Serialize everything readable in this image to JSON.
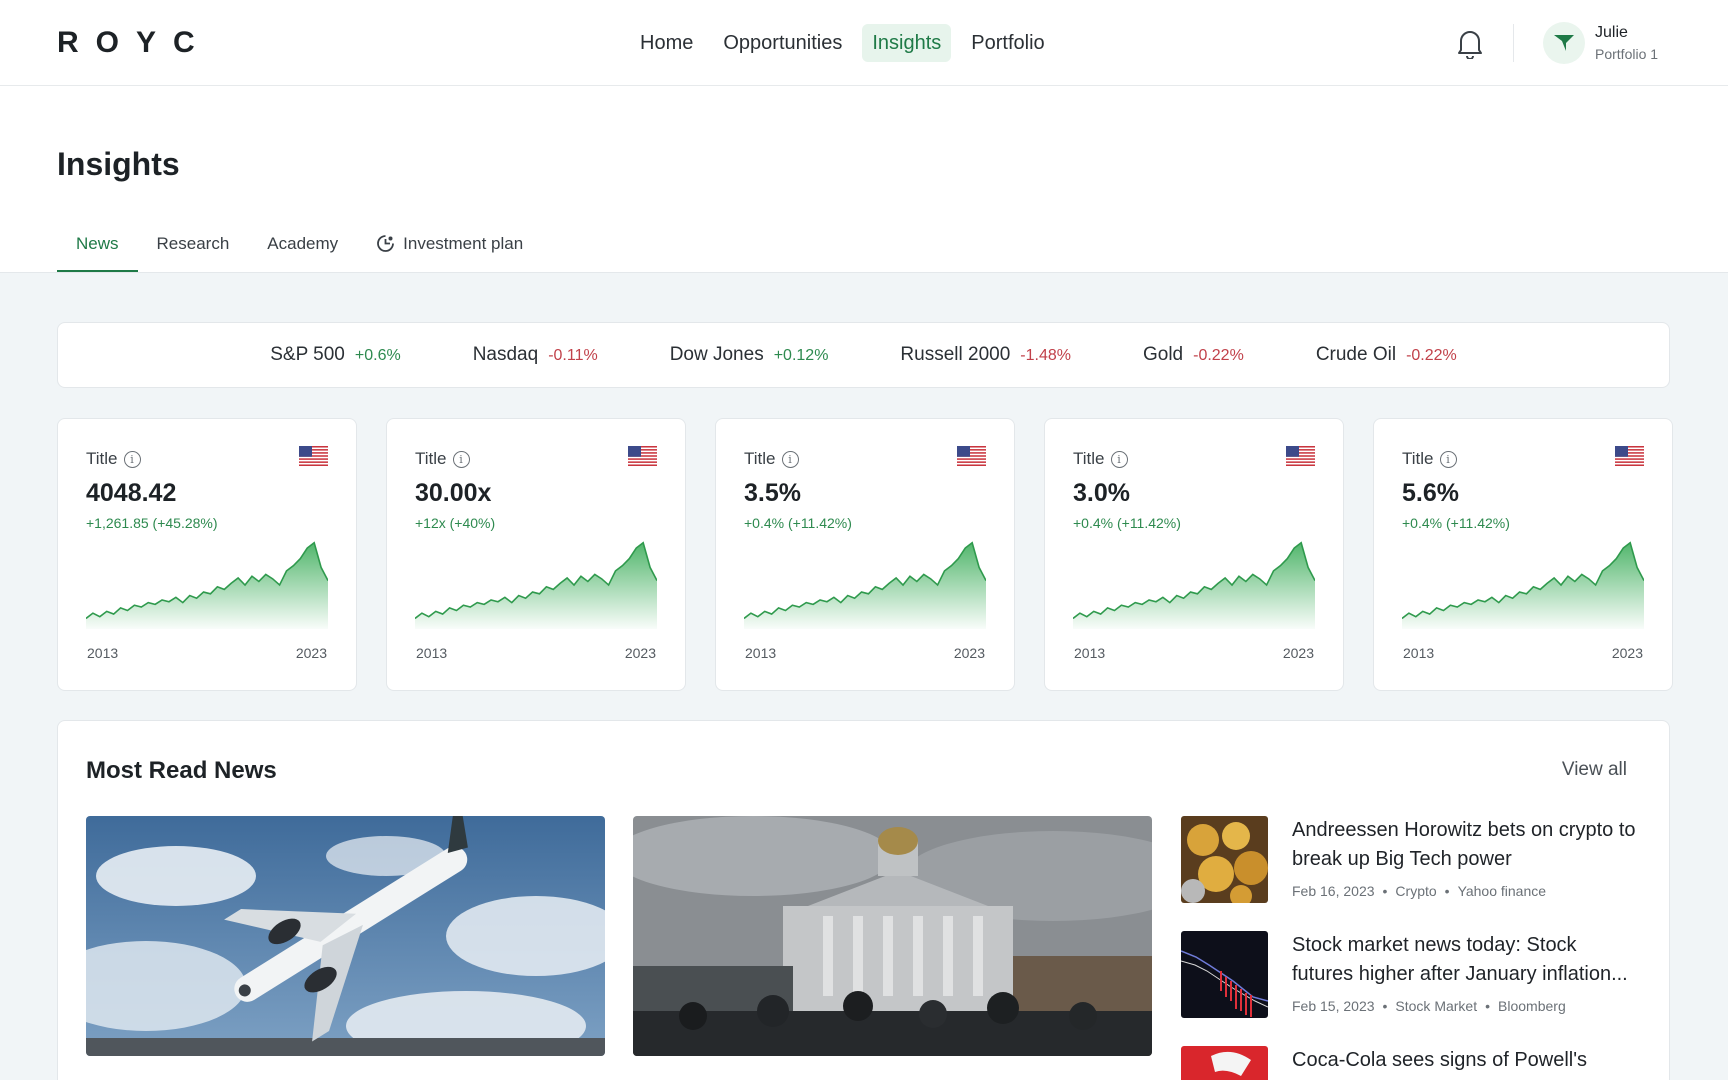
{
  "app": {
    "logo": "ROYC"
  },
  "nav": {
    "items": [
      {
        "label": "Home",
        "active": false
      },
      {
        "label": "Opportunities",
        "active": false
      },
      {
        "label": "Insights",
        "active": true
      },
      {
        "label": "Portfolio",
        "active": false
      }
    ]
  },
  "user": {
    "name": "Julie",
    "portfolio": "Portfolio 1",
    "avatar_icon": "funnel-icon"
  },
  "page": {
    "title": "Insights"
  },
  "tabs": [
    {
      "label": "News",
      "active": true
    },
    {
      "label": "Research",
      "active": false
    },
    {
      "label": "Academy",
      "active": false
    },
    {
      "label": "Investment plan",
      "active": false,
      "icon": "plan-icon"
    }
  ],
  "ticker": [
    {
      "name": "S&P 500",
      "change": "+0.6%",
      "direction": "up"
    },
    {
      "name": "Nasdaq",
      "change": "-0.11%",
      "direction": "down"
    },
    {
      "name": "Dow Jones",
      "change": "+0.12%",
      "direction": "up"
    },
    {
      "name": "Russell 2000",
      "change": "-1.48%",
      "direction": "down"
    },
    {
      "name": "Gold",
      "change": "-0.22%",
      "direction": "down"
    },
    {
      "name": "Crude Oil",
      "change": "-0.22%",
      "direction": "down"
    }
  ],
  "cards": [
    {
      "title": "Title",
      "value": "4048.42",
      "change": "+1,261.85 (+45.28%)",
      "x_start": "2013",
      "x_end": "2023"
    },
    {
      "title": "Title",
      "value": "30.00x",
      "change": "+12x (+40%)",
      "x_start": "2013",
      "x_end": "2023"
    },
    {
      "title": "Title",
      "value": "3.5%",
      "change": "+0.4% (+11.42%)",
      "x_start": "2013",
      "x_end": "2023"
    },
    {
      "title": "Title",
      "value": "3.0%",
      "change": "+0.4% (+11.42%)",
      "x_start": "2013",
      "x_end": "2023"
    },
    {
      "title": "Title",
      "value": "5.6%",
      "change": "+0.4% (+11.42%)",
      "x_start": "2013",
      "x_end": "2023"
    }
  ],
  "colors": {
    "accent": "#1f7a47",
    "positive": "#2e8a4f",
    "negative": "#c1414a",
    "spark": "#3fae5c"
  },
  "news": {
    "title": "Most Read News",
    "view_all": "View all",
    "featured": [
      {
        "image": "airplane-photo"
      },
      {
        "image": "capitol-protest-photo"
      }
    ],
    "list": [
      {
        "title": "Andreessen Horowitz bets on crypto to break up Big Tech power",
        "date": "Feb 16, 2023",
        "category": "Crypto",
        "source": "Yahoo finance",
        "thumb": "coins-thumbnail"
      },
      {
        "title": "Stock market news today: Stock futures higher after January inflation...",
        "date": "Feb 15, 2023",
        "category": "Stock Market",
        "source": "Bloomberg",
        "thumb": "stock-chart-thumbnail"
      },
      {
        "title": "Coca-Cola sees signs of Powell's",
        "thumb": "coca-cola-thumbnail"
      }
    ]
  }
}
